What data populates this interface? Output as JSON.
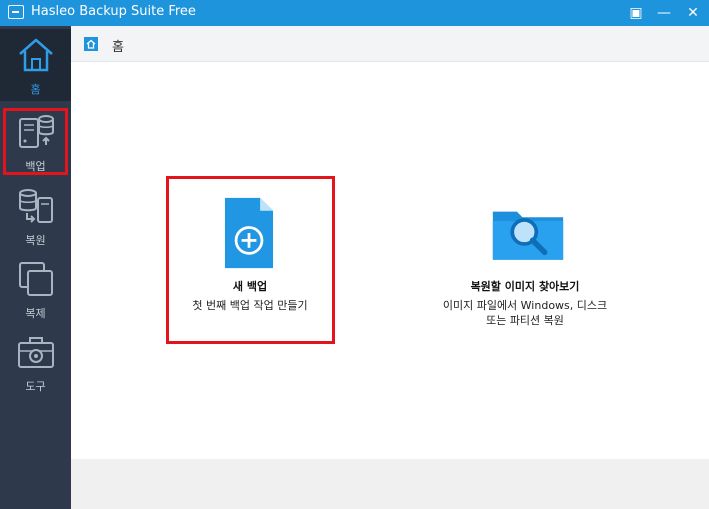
{
  "window": {
    "title": "Hasleo Backup Suite Free",
    "controls": {
      "menu": "▣",
      "minimize": "—",
      "close": "✕"
    }
  },
  "sidebar": {
    "items": [
      {
        "label": "홈",
        "icon": "home-icon",
        "active": true
      },
      {
        "label": "백업",
        "icon": "backup-icon",
        "active": false
      },
      {
        "label": "복원",
        "icon": "restore-icon",
        "active": false
      },
      {
        "label": "복제",
        "icon": "clone-icon",
        "active": false
      },
      {
        "label": "도구",
        "icon": "tools-icon",
        "active": false
      }
    ]
  },
  "breadcrumb": {
    "current": "홈"
  },
  "main": {
    "new_backup": {
      "title": "새 백업",
      "description": "첫 번째 백업 작업 만들기",
      "icon": "add-file-icon"
    },
    "browse_image": {
      "title": "복원할 이미지 찾아보기",
      "description_line1": "이미지 파일에서 Windows, 디스크",
      "description_line2": "또는 파티션 복원",
      "icon": "folder-search-icon"
    }
  },
  "colors": {
    "accent": "#1e94dc",
    "sidebar_bg": "#2e3a4b",
    "highlight": "#e3141b"
  }
}
